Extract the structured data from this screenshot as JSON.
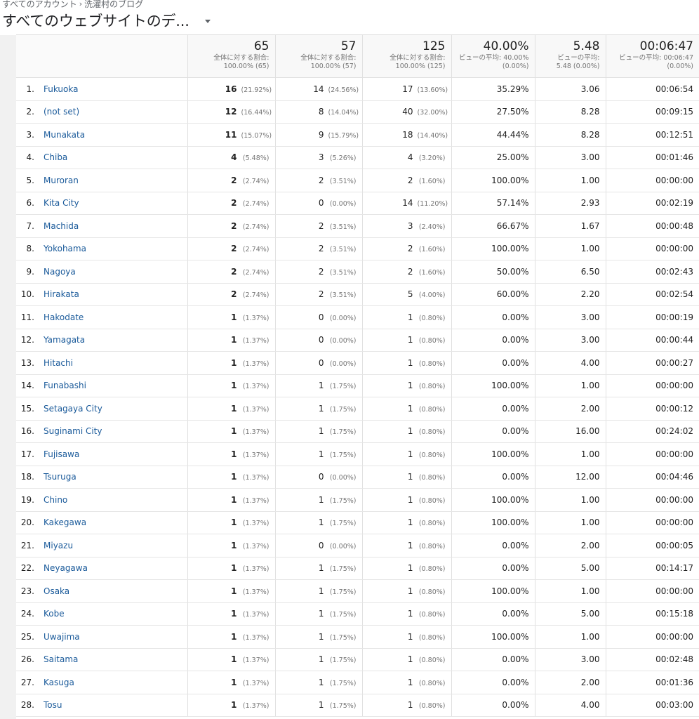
{
  "breadcrumb": {
    "account": "すべてのアカウント",
    "property": "洗濯村のブログ"
  },
  "view_title": "すべてのウェブサイトのデ...",
  "totals": [
    {
      "total": "65",
      "sub1": "全体に対する割合:",
      "sub2": "100.00% (65)"
    },
    {
      "total": "57",
      "sub1": "全体に対する割合:",
      "sub2": "100.00% (57)"
    },
    {
      "total": "125",
      "sub1": "全体に対する割合:",
      "sub2": "100.00% (125)"
    },
    {
      "total": "40.00%",
      "sub1": "ビューの平均: 40.00%",
      "sub2": "(0.00%)"
    },
    {
      "total": "5.48",
      "sub1": "ビューの平均:",
      "sub2": "5.48 (0.00%)"
    },
    {
      "total": "00:06:47",
      "sub1": "ビューの平均: 00:06:47",
      "sub2": "(0.00%)"
    }
  ],
  "rows": [
    {
      "idx": "1.",
      "city": "Fukuoka",
      "sessions": "16",
      "sessions_pct": "(21.92%)",
      "users": "14",
      "users_pct": "(24.56%)",
      "pageviews": "17",
      "pageviews_pct": "(13.60%)",
      "bounce": "35.29%",
      "ppv": "3.06",
      "dur": "00:06:54"
    },
    {
      "idx": "2.",
      "city": "(not set)",
      "sessions": "12",
      "sessions_pct": "(16.44%)",
      "users": "8",
      "users_pct": "(14.04%)",
      "pageviews": "40",
      "pageviews_pct": "(32.00%)",
      "bounce": "27.50%",
      "ppv": "8.28",
      "dur": "00:09:15"
    },
    {
      "idx": "3.",
      "city": "Munakata",
      "sessions": "11",
      "sessions_pct": "(15.07%)",
      "users": "9",
      "users_pct": "(15.79%)",
      "pageviews": "18",
      "pageviews_pct": "(14.40%)",
      "bounce": "44.44%",
      "ppv": "8.28",
      "dur": "00:12:51"
    },
    {
      "idx": "4.",
      "city": "Chiba",
      "sessions": "4",
      "sessions_pct": "(5.48%)",
      "users": "3",
      "users_pct": "(5.26%)",
      "pageviews": "4",
      "pageviews_pct": "(3.20%)",
      "bounce": "25.00%",
      "ppv": "3.00",
      "dur": "00:01:46"
    },
    {
      "idx": "5.",
      "city": "Muroran",
      "sessions": "2",
      "sessions_pct": "(2.74%)",
      "users": "2",
      "users_pct": "(3.51%)",
      "pageviews": "2",
      "pageviews_pct": "(1.60%)",
      "bounce": "100.00%",
      "ppv": "1.00",
      "dur": "00:00:00"
    },
    {
      "idx": "6.",
      "city": "Kita City",
      "sessions": "2",
      "sessions_pct": "(2.74%)",
      "users": "0",
      "users_pct": "(0.00%)",
      "pageviews": "14",
      "pageviews_pct": "(11.20%)",
      "bounce": "57.14%",
      "ppv": "2.93",
      "dur": "00:02:19"
    },
    {
      "idx": "7.",
      "city": "Machida",
      "sessions": "2",
      "sessions_pct": "(2.74%)",
      "users": "2",
      "users_pct": "(3.51%)",
      "pageviews": "3",
      "pageviews_pct": "(2.40%)",
      "bounce": "66.67%",
      "ppv": "1.67",
      "dur": "00:00:48"
    },
    {
      "idx": "8.",
      "city": "Yokohama",
      "sessions": "2",
      "sessions_pct": "(2.74%)",
      "users": "2",
      "users_pct": "(3.51%)",
      "pageviews": "2",
      "pageviews_pct": "(1.60%)",
      "bounce": "100.00%",
      "ppv": "1.00",
      "dur": "00:00:00"
    },
    {
      "idx": "9.",
      "city": "Nagoya",
      "sessions": "2",
      "sessions_pct": "(2.74%)",
      "users": "2",
      "users_pct": "(3.51%)",
      "pageviews": "2",
      "pageviews_pct": "(1.60%)",
      "bounce": "50.00%",
      "ppv": "6.50",
      "dur": "00:02:43"
    },
    {
      "idx": "10.",
      "city": "Hirakata",
      "sessions": "2",
      "sessions_pct": "(2.74%)",
      "users": "2",
      "users_pct": "(3.51%)",
      "pageviews": "5",
      "pageviews_pct": "(4.00%)",
      "bounce": "60.00%",
      "ppv": "2.20",
      "dur": "00:02:54"
    },
    {
      "idx": "11.",
      "city": "Hakodate",
      "sessions": "1",
      "sessions_pct": "(1.37%)",
      "users": "0",
      "users_pct": "(0.00%)",
      "pageviews": "1",
      "pageviews_pct": "(0.80%)",
      "bounce": "0.00%",
      "ppv": "3.00",
      "dur": "00:00:19"
    },
    {
      "idx": "12.",
      "city": "Yamagata",
      "sessions": "1",
      "sessions_pct": "(1.37%)",
      "users": "0",
      "users_pct": "(0.00%)",
      "pageviews": "1",
      "pageviews_pct": "(0.80%)",
      "bounce": "0.00%",
      "ppv": "3.00",
      "dur": "00:00:44"
    },
    {
      "idx": "13.",
      "city": "Hitachi",
      "sessions": "1",
      "sessions_pct": "(1.37%)",
      "users": "0",
      "users_pct": "(0.00%)",
      "pageviews": "1",
      "pageviews_pct": "(0.80%)",
      "bounce": "0.00%",
      "ppv": "4.00",
      "dur": "00:00:27"
    },
    {
      "idx": "14.",
      "city": "Funabashi",
      "sessions": "1",
      "sessions_pct": "(1.37%)",
      "users": "1",
      "users_pct": "(1.75%)",
      "pageviews": "1",
      "pageviews_pct": "(0.80%)",
      "bounce": "100.00%",
      "ppv": "1.00",
      "dur": "00:00:00"
    },
    {
      "idx": "15.",
      "city": "Setagaya City",
      "sessions": "1",
      "sessions_pct": "(1.37%)",
      "users": "1",
      "users_pct": "(1.75%)",
      "pageviews": "1",
      "pageviews_pct": "(0.80%)",
      "bounce": "0.00%",
      "ppv": "2.00",
      "dur": "00:00:12"
    },
    {
      "idx": "16.",
      "city": "Suginami City",
      "sessions": "1",
      "sessions_pct": "(1.37%)",
      "users": "1",
      "users_pct": "(1.75%)",
      "pageviews": "1",
      "pageviews_pct": "(0.80%)",
      "bounce": "0.00%",
      "ppv": "16.00",
      "dur": "00:24:02"
    },
    {
      "idx": "17.",
      "city": "Fujisawa",
      "sessions": "1",
      "sessions_pct": "(1.37%)",
      "users": "1",
      "users_pct": "(1.75%)",
      "pageviews": "1",
      "pageviews_pct": "(0.80%)",
      "bounce": "100.00%",
      "ppv": "1.00",
      "dur": "00:00:00"
    },
    {
      "idx": "18.",
      "city": "Tsuruga",
      "sessions": "1",
      "sessions_pct": "(1.37%)",
      "users": "0",
      "users_pct": "(0.00%)",
      "pageviews": "1",
      "pageviews_pct": "(0.80%)",
      "bounce": "0.00%",
      "ppv": "12.00",
      "dur": "00:04:46"
    },
    {
      "idx": "19.",
      "city": "Chino",
      "sessions": "1",
      "sessions_pct": "(1.37%)",
      "users": "1",
      "users_pct": "(1.75%)",
      "pageviews": "1",
      "pageviews_pct": "(0.80%)",
      "bounce": "100.00%",
      "ppv": "1.00",
      "dur": "00:00:00"
    },
    {
      "idx": "20.",
      "city": "Kakegawa",
      "sessions": "1",
      "sessions_pct": "(1.37%)",
      "users": "1",
      "users_pct": "(1.75%)",
      "pageviews": "1",
      "pageviews_pct": "(0.80%)",
      "bounce": "100.00%",
      "ppv": "1.00",
      "dur": "00:00:00"
    },
    {
      "idx": "21.",
      "city": "Miyazu",
      "sessions": "1",
      "sessions_pct": "(1.37%)",
      "users": "0",
      "users_pct": "(0.00%)",
      "pageviews": "1",
      "pageviews_pct": "(0.80%)",
      "bounce": "0.00%",
      "ppv": "2.00",
      "dur": "00:00:05"
    },
    {
      "idx": "22.",
      "city": "Neyagawa",
      "sessions": "1",
      "sessions_pct": "(1.37%)",
      "users": "1",
      "users_pct": "(1.75%)",
      "pageviews": "1",
      "pageviews_pct": "(0.80%)",
      "bounce": "0.00%",
      "ppv": "5.00",
      "dur": "00:14:17"
    },
    {
      "idx": "23.",
      "city": "Osaka",
      "sessions": "1",
      "sessions_pct": "(1.37%)",
      "users": "1",
      "users_pct": "(1.75%)",
      "pageviews": "1",
      "pageviews_pct": "(0.80%)",
      "bounce": "100.00%",
      "ppv": "1.00",
      "dur": "00:00:00"
    },
    {
      "idx": "24.",
      "city": "Kobe",
      "sessions": "1",
      "sessions_pct": "(1.37%)",
      "users": "1",
      "users_pct": "(1.75%)",
      "pageviews": "1",
      "pageviews_pct": "(0.80%)",
      "bounce": "0.00%",
      "ppv": "5.00",
      "dur": "00:15:18"
    },
    {
      "idx": "25.",
      "city": "Uwajima",
      "sessions": "1",
      "sessions_pct": "(1.37%)",
      "users": "1",
      "users_pct": "(1.75%)",
      "pageviews": "1",
      "pageviews_pct": "(0.80%)",
      "bounce": "100.00%",
      "ppv": "1.00",
      "dur": "00:00:00"
    },
    {
      "idx": "26.",
      "city": "Saitama",
      "sessions": "1",
      "sessions_pct": "(1.37%)",
      "users": "1",
      "users_pct": "(1.75%)",
      "pageviews": "1",
      "pageviews_pct": "(0.80%)",
      "bounce": "0.00%",
      "ppv": "3.00",
      "dur": "00:02:48"
    },
    {
      "idx": "27.",
      "city": "Kasuga",
      "sessions": "1",
      "sessions_pct": "(1.37%)",
      "users": "1",
      "users_pct": "(1.75%)",
      "pageviews": "1",
      "pageviews_pct": "(0.80%)",
      "bounce": "0.00%",
      "ppv": "2.00",
      "dur": "00:01:36"
    },
    {
      "idx": "28.",
      "city": "Tosu",
      "sessions": "1",
      "sessions_pct": "(1.37%)",
      "users": "1",
      "users_pct": "(1.75%)",
      "pageviews": "1",
      "pageviews_pct": "(0.80%)",
      "bounce": "0.00%",
      "ppv": "4.00",
      "dur": "00:03:00"
    }
  ],
  "colors": {
    "link": "#1a5a9a",
    "header_bg": "#f8f8f8",
    "border": "#e0e0e0"
  },
  "icons": {
    "breadcrumb_separator": "chevron-right-icon",
    "view_selector": "caret-down-icon"
  }
}
